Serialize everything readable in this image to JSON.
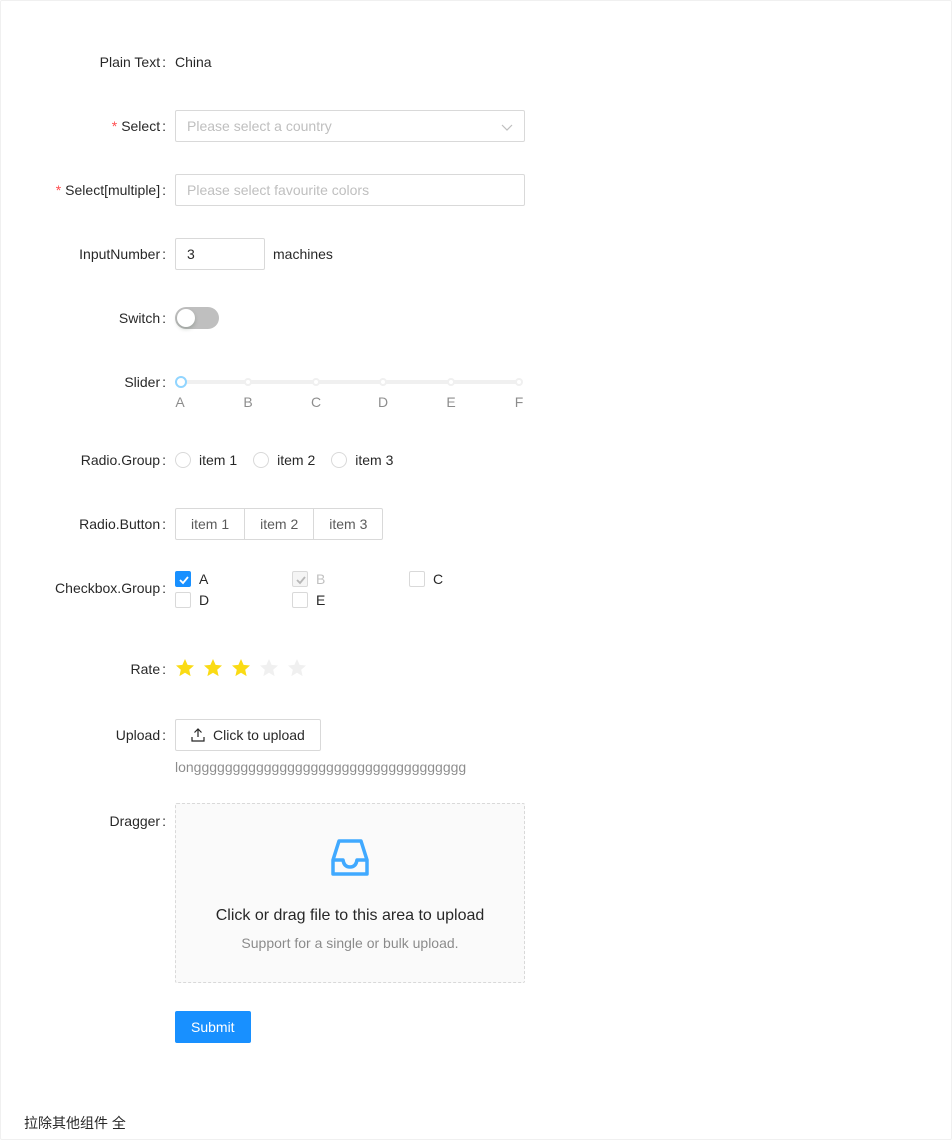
{
  "form": {
    "plain_text": {
      "label": "Plain Text",
      "value": "China"
    },
    "select": {
      "label": "Select",
      "placeholder": "Please select a country",
      "required": true
    },
    "select_multiple": {
      "label": "Select[multiple]",
      "placeholder": "Please select favourite colors",
      "required": true
    },
    "input_number": {
      "label": "InputNumber",
      "value": "3",
      "suffix": "machines"
    },
    "switch": {
      "label": "Switch",
      "checked": false
    },
    "slider": {
      "label": "Slider",
      "value": "A",
      "marks": [
        "A",
        "B",
        "C",
        "D",
        "E",
        "F"
      ]
    },
    "radio_group": {
      "label": "Radio.Group",
      "options": [
        "item 1",
        "item 2",
        "item 3"
      ]
    },
    "radio_button": {
      "label": "Radio.Button",
      "options": [
        "item 1",
        "item 2",
        "item 3"
      ]
    },
    "checkbox_group": {
      "label": "Checkbox.Group",
      "options": [
        {
          "label": "A",
          "checked": true,
          "disabled": false
        },
        {
          "label": "B",
          "checked": true,
          "disabled": true
        },
        {
          "label": "C",
          "checked": false,
          "disabled": false
        },
        {
          "label": "D",
          "checked": false,
          "disabled": false
        },
        {
          "label": "E",
          "checked": false,
          "disabled": false
        }
      ]
    },
    "rate": {
      "label": "Rate",
      "value": 3,
      "max": 5
    },
    "upload": {
      "label": "Upload",
      "button_label": "Click to upload",
      "file_name": "longgggggggggggggggggggggggggggggggggg"
    },
    "dragger": {
      "label": "Dragger",
      "title": "Click or drag file to this area to upload",
      "hint": "Support for a single or bulk upload."
    },
    "submit_label": "Submit"
  },
  "footer_text": "拉除其他组件 全",
  "colors": {
    "primary": "#1890ff",
    "required": "#ff4d4f",
    "star_active": "#fadb14",
    "star_inactive": "#f0f0f0"
  }
}
